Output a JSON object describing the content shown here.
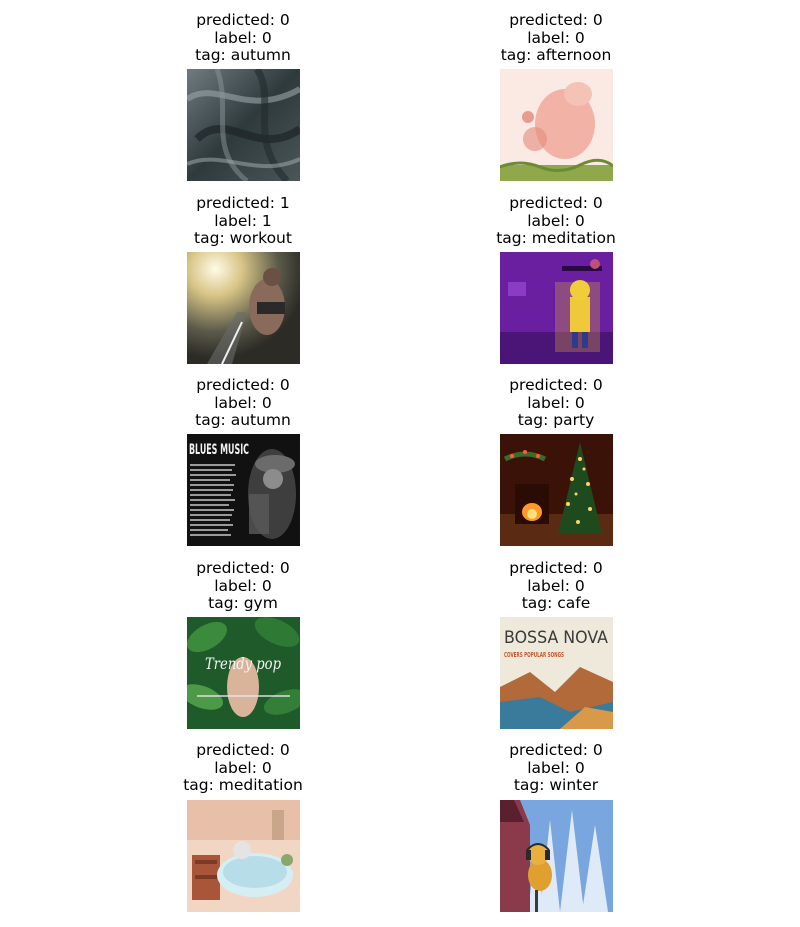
{
  "figure": {
    "cells": [
      {
        "predicted": "predicted: 0",
        "label": "label: 0",
        "tag": "tag: autumn",
        "image": "dark-crumpled-fabric-with-script-text"
      },
      {
        "predicted": "predicted: 0",
        "label": "label: 0",
        "tag": "tag: afternoon",
        "image": "pink-cartoon-creature-with-flowers"
      },
      {
        "predicted": "predicted: 1",
        "label": "label: 1",
        "tag": "tag: workout",
        "image": "athlete-crouching-on-track-sunlight"
      },
      {
        "predicted": "predicted: 0",
        "label": "label: 0",
        "tag": "tag: meditation",
        "image": "purple-cartoon-room-character"
      },
      {
        "predicted": "predicted: 0",
        "label": "label: 0",
        "tag": "tag: autumn",
        "image": "blues-music-album-cover",
        "image_text": "BLUES MUSIC"
      },
      {
        "predicted": "predicted: 0",
        "label": "label: 0",
        "tag": "tag: party",
        "image": "christmas-tree-and-fireplace"
      },
      {
        "predicted": "predicted: 0",
        "label": "label: 0",
        "tag": "tag: gym",
        "image": "green-leaves-trendy-pop-cover",
        "image_text": "Trendy pop"
      },
      {
        "predicted": "predicted: 0",
        "label": "label: 0",
        "tag": "tag: cafe",
        "image": "bossa-nova-covers-album",
        "image_text": "BOSSA NOVA",
        "image_subtext": "COVERS POPULAR SONGS"
      },
      {
        "predicted": "predicted: 0",
        "label": "label: 0",
        "tag": "tag: meditation",
        "image": "illustrated-person-in-bathtub"
      },
      {
        "predicted": "predicted: 0",
        "label": "label: 0",
        "tag": "tag: winter",
        "image": "cartoon-dog-with-headphones-snowy-trees"
      }
    ]
  }
}
